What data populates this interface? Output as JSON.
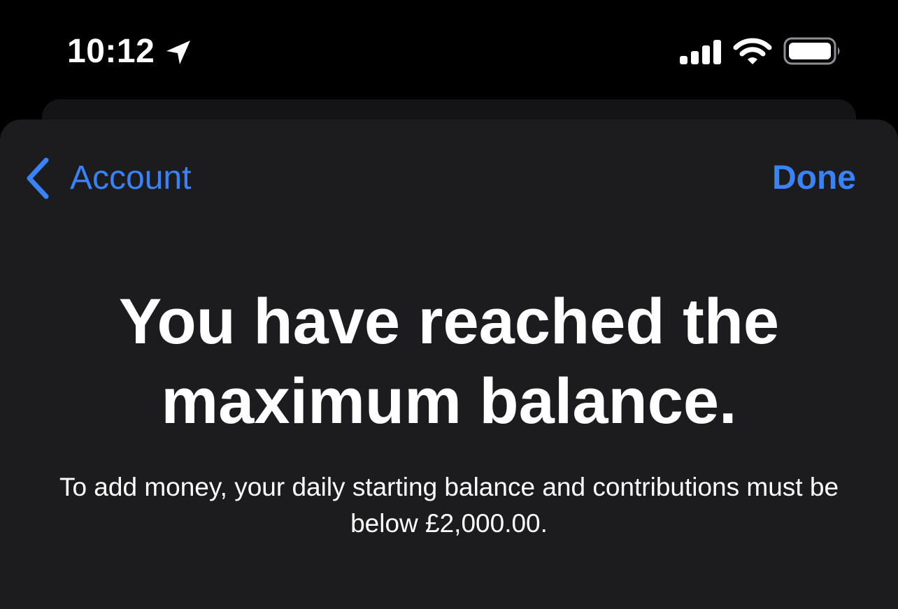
{
  "status_bar": {
    "time": "10:12",
    "icons": [
      "location-arrow-icon",
      "cellular-signal-icon",
      "wifi-icon",
      "battery-icon"
    ]
  },
  "nav": {
    "back_label": "Account",
    "done_label": "Done"
  },
  "main": {
    "headline": "You have reached the maximum balance.",
    "message": "To add money, your daily starting balance and contributions must be below £2,000.00."
  },
  "colors": {
    "background": "#000000",
    "sheet": "#1c1c1e",
    "accent": "#3a82f7",
    "text": "#ffffff"
  }
}
